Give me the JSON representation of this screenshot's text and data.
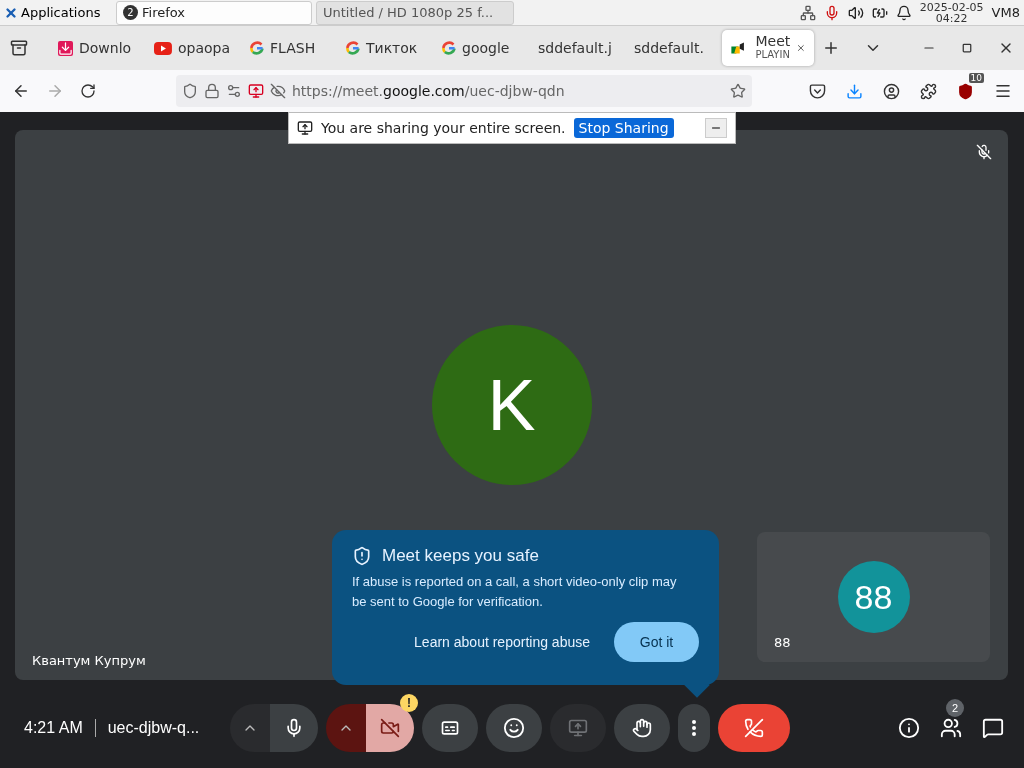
{
  "taskbar": {
    "apps_label": "Applications",
    "windows": [
      {
        "title": "Firefox",
        "badge": "2",
        "selected": true
      },
      {
        "title": "Untitled / HD 1080p 25 f...",
        "selected": false
      }
    ],
    "date": "2025-02-05",
    "time": "04:22",
    "user": "VM8"
  },
  "tabs": [
    {
      "title": "Downlo",
      "kind": "download",
      "selected": false
    },
    {
      "title": "opaopa",
      "kind": "video",
      "selected": false
    },
    {
      "title": "FLASH",
      "kind": "google",
      "selected": false
    },
    {
      "title": "Тикток",
      "kind": "google",
      "selected": false
    },
    {
      "title": "google",
      "kind": "google",
      "selected": false
    },
    {
      "title": "sddefault.j",
      "kind": "none",
      "selected": false
    },
    {
      "title": "sddefault.",
      "kind": "none",
      "selected": false
    },
    {
      "title": "Meet",
      "subtitle": "PLAYIN",
      "kind": "meet",
      "selected": true
    }
  ],
  "address_bar": {
    "url_prefix": "https://meet.",
    "url_domain": "google.com",
    "url_path": "/uec-djbw-qdn",
    "extension_badge": "10"
  },
  "sharing_bar": {
    "message": "You are sharing your entire screen.",
    "button": "Stop Sharing"
  },
  "main_tile": {
    "initial": "K",
    "name": "Квантум Купрум",
    "muted": true
  },
  "self_tile": {
    "initial": "88",
    "name": "88"
  },
  "popup": {
    "title": "Meet keeps you safe",
    "body": "If abuse is reported on a call, a short video-only clip may be sent to Google for verification.",
    "link": "Learn about reporting abuse",
    "button": "Got it"
  },
  "bottom_bar": {
    "time": "4:21 AM",
    "meeting_code": "uec-djbw-q...",
    "controls": [
      {
        "kind": "mic",
        "on": true,
        "disabled": false
      },
      {
        "kind": "camera",
        "on": false,
        "disabled": false,
        "alert": "!"
      },
      {
        "kind": "captions",
        "on": false,
        "disabled": false
      },
      {
        "kind": "reactions",
        "on": false,
        "disabled": false
      },
      {
        "kind": "present",
        "on": false,
        "disabled": true
      },
      {
        "kind": "hand",
        "on": false,
        "disabled": false
      }
    ],
    "people_count": "2"
  }
}
